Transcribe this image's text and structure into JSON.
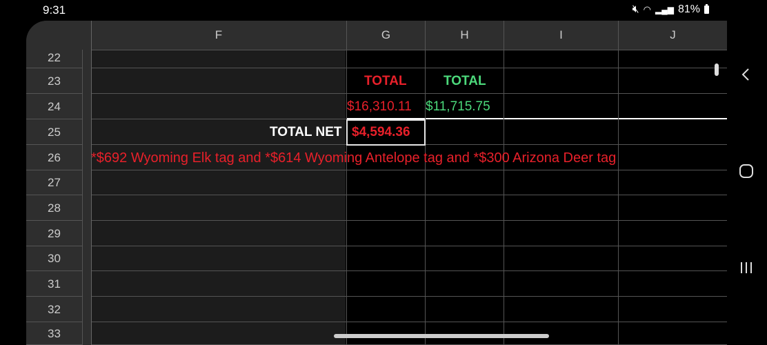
{
  "status": {
    "time": "9:31",
    "battery": "81%"
  },
  "columns": [
    "F",
    "G",
    "H",
    "I",
    "J"
  ],
  "rows": [
    "22",
    "23",
    "24",
    "25",
    "26",
    "27",
    "28",
    "29",
    "30",
    "31",
    "32",
    "33"
  ],
  "cells": {
    "g23": "TOTAL",
    "h23": "TOTAL",
    "g24": "$16,310.11",
    "h24": "$11,715.75",
    "f25": "TOTAL NET",
    "g25": "$4,594.36",
    "f26": "*$692 Wyoming Elk tag and *$614 Wyoming Antelope tag and *$300 Arizona Deer tag"
  },
  "colors": {
    "red": "#e8202a",
    "green": "#4cd97b"
  },
  "icons": [
    "mute-icon",
    "wifi-icon",
    "signal-icon",
    "battery-icon",
    "back-icon",
    "home-icon",
    "recents-icon"
  ]
}
